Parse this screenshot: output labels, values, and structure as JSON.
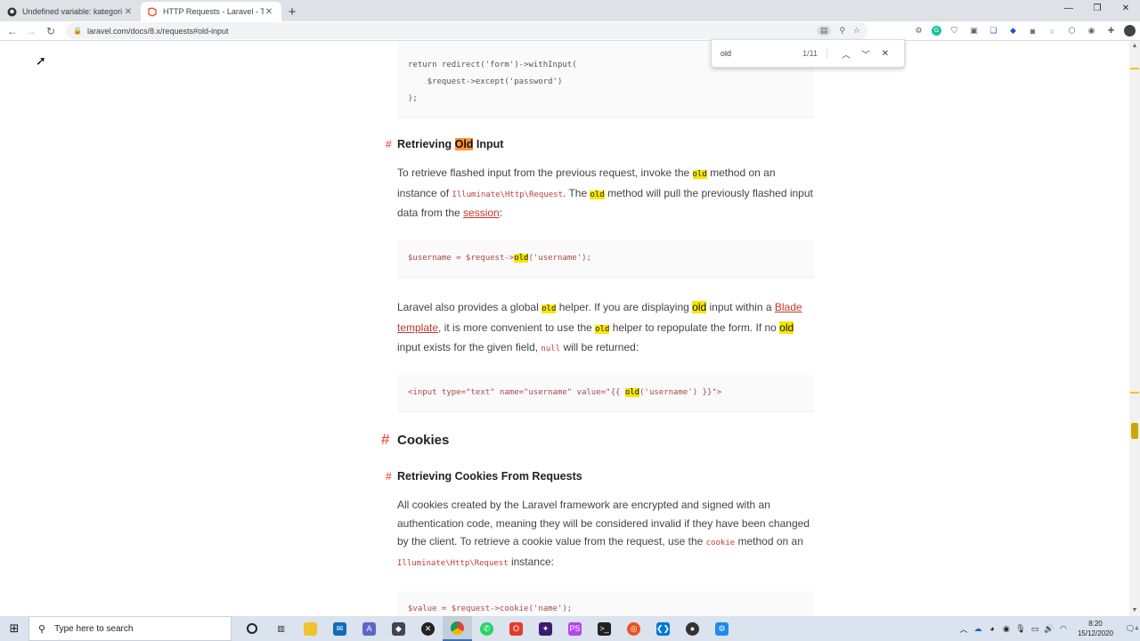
{
  "browser": {
    "tabs": [
      {
        "title": "Undefined variable: kategori"
      },
      {
        "title": "HTTP Requests - Laravel - The PHP"
      }
    ],
    "url": "laravel.com/docs/8.x/requests#old-input",
    "find": {
      "query": "old",
      "count": "1/11"
    }
  },
  "content": {
    "code1": [
      "return redirect('form')->withInput(",
      "    $request->except('password')",
      ");"
    ],
    "h_old": {
      "pre": "Retrieving ",
      "hl": "Old",
      "post": " Input"
    },
    "p1": {
      "t1": "To retrieve flashed input from the previous request, invoke the ",
      "c1": "old",
      "t2": " method on an instance of ",
      "c2": "Illuminate\\Http\\Request",
      "t3": ". The ",
      "c3": "old",
      "t4": " method will pull the previously flashed input data from the ",
      "link": "session",
      "t5": ":"
    },
    "code2": {
      "a": "$username = $request->",
      "hl": "old",
      "b": "('username');"
    },
    "p2": {
      "t1": "Laravel also provides a global ",
      "c1": "old",
      "t2": " helper. If you are displaying ",
      "w1": "old",
      "t3": " input within a ",
      "link": "Blade template",
      "t4": ", it is more convenient to use the ",
      "c2": "old",
      "t5": " helper to repopulate the form. If no ",
      "w2": "old",
      "t6": " input exists for the given field, ",
      "c3": "null",
      "t7": " will be returned:"
    },
    "code3": {
      "a": "<input type=\"text\" name=\"username\" value=\"{{ ",
      "hl": "old",
      "b": "('username') }}\">"
    },
    "h_cookies": "Cookies",
    "h_retrieving_cookies": "Retrieving Cookies From Requests",
    "p3": {
      "t1": "All cookies created by the Laravel framework are encrypted and signed with an authentication code, meaning they will be considered invalid if they have been changed by the client. To retrieve a cookie value from the request, use the ",
      "c1": "cookie",
      "t2": " method on an ",
      "c2": "Illuminate\\Http\\Request",
      "t3": " instance:"
    },
    "code4": "$value = $request->cookie('name');"
  },
  "taskbar": {
    "search_placeholder": "Type here to search",
    "time": "8:20",
    "date": "15/12/2020",
    "notifications": "4"
  },
  "colors": {
    "accent": "#ff2d20",
    "highlight": "#f7e600",
    "active_match": "#ff9632"
  }
}
